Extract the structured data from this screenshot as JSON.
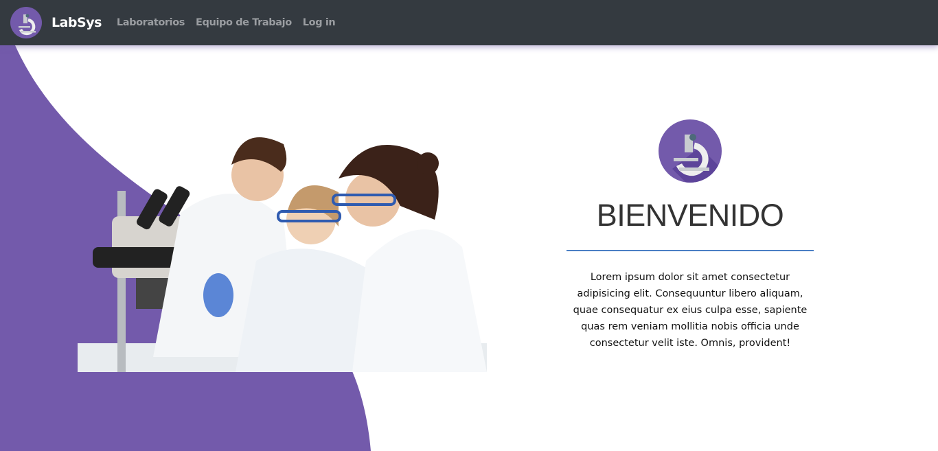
{
  "navbar": {
    "brand": "LabSys",
    "links": [
      "Laboratorios",
      "Equipo de Trabajo",
      "Log in"
    ]
  },
  "hero": {
    "title": "BIENVENIDO",
    "text": "Lorem ipsum dolor sit amet consectetur adipisicing elit. Consequuntur libero aliquam, quae consequatur ex eius culpa esse, sapiente quas rem veniam mollitia nobis officia unde consectetur velit iste. Omnis, provident!"
  },
  "colors": {
    "accent": "#735aab",
    "nav": "#343a40",
    "divider": "#4a7fc4"
  }
}
